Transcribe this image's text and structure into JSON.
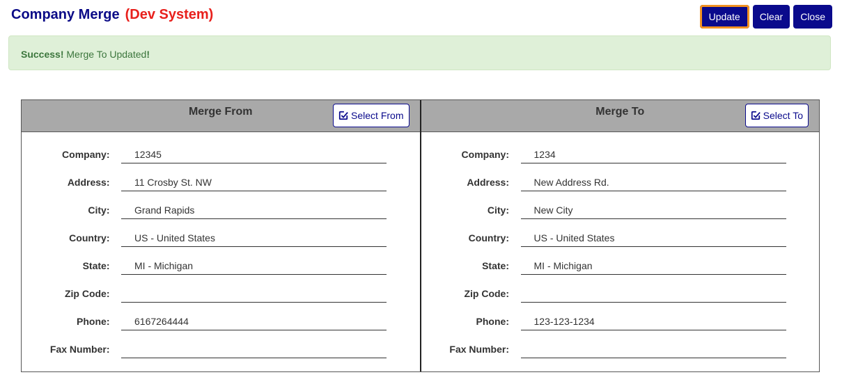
{
  "header": {
    "title": "Company Merge",
    "environment": "(Dev System)"
  },
  "toolbar": {
    "update_label": "Update",
    "clear_label": "Clear",
    "close_label": "Close"
  },
  "alert": {
    "strong": "Success!",
    "message": " Merge To Updated",
    "suffix": "!"
  },
  "merge_from": {
    "title": "Merge From",
    "select_label": "Select From",
    "icon": "edit-check-icon",
    "fields": {
      "company_label": "Company:",
      "company": "12345",
      "address_label": "Address:",
      "address": "11 Crosby St. NW",
      "city_label": "City:",
      "city": "Grand Rapids",
      "country_label": "Country:",
      "country": "US - United States",
      "state_label": "State:",
      "state": "MI - Michigan",
      "zip_label": "Zip Code:",
      "zip": "",
      "phone_label": "Phone:",
      "phone": "6167264444",
      "fax_label": "Fax Number:",
      "fax": ""
    }
  },
  "merge_to": {
    "title": "Merge To",
    "select_label": "Select To",
    "icon": "edit-check-icon",
    "fields": {
      "company_label": "Company:",
      "company": "1234",
      "address_label": "Address:",
      "address": "New Address Rd.",
      "city_label": "City:",
      "city": "New City",
      "country_label": "Country:",
      "country": "US - United States",
      "state_label": "State:",
      "state": "MI - Michigan",
      "zip_label": "Zip Code:",
      "zip": "",
      "phone_label": "Phone:",
      "phone": "123-123-1234",
      "fax_label": "Fax Number:",
      "fax": ""
    }
  },
  "colors": {
    "primary": "#0a0a8c",
    "dev_red": "#e8201c",
    "success_bg": "#dff0d8",
    "success_text": "#3c763d",
    "header_gray": "#a9a9a9",
    "focus_orange": "#f29222"
  }
}
